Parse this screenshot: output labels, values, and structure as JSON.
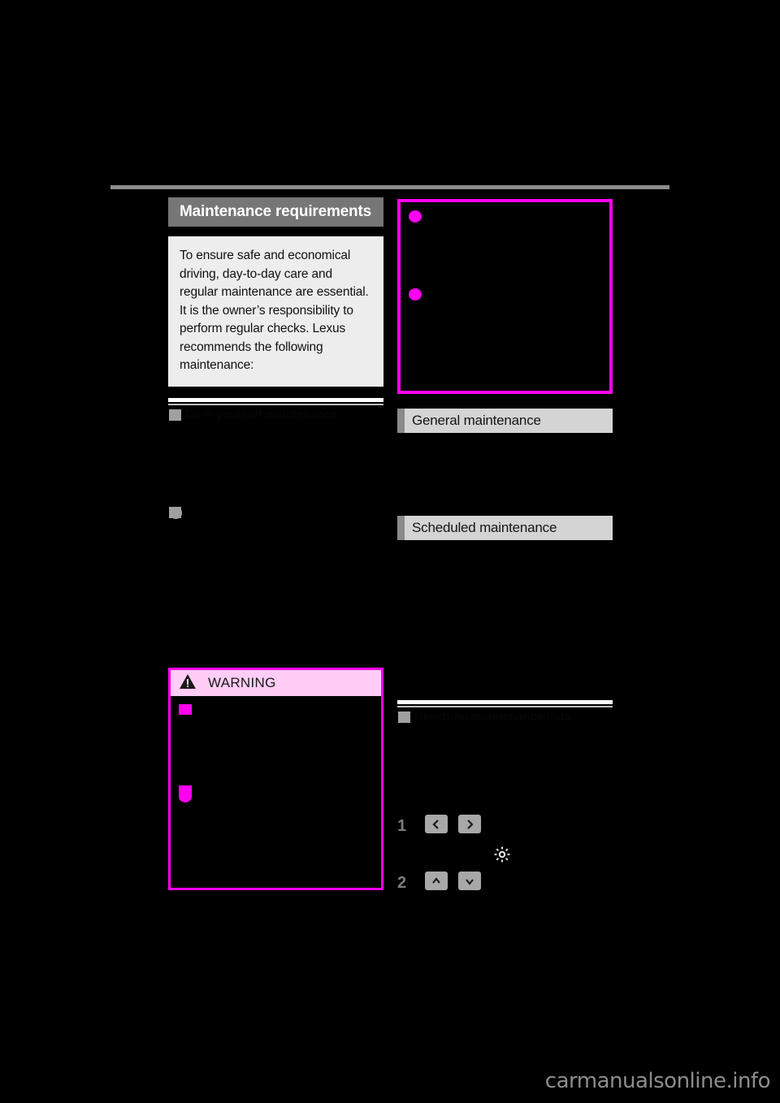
{
  "page": {
    "background_color": "#000000",
    "accent_magenta": "#ff00f0",
    "accent_pink_header": "#ffcdf6",
    "gray_title_bar": "#767676",
    "gray_subhead": "#d4d4d4",
    "watermark": "carmanualsonline.info"
  },
  "left_column": {
    "section_title": "Maintenance requirements",
    "intro_text": "To ensure safe and economical driving, day-to-day care and regular maintenance are essential. It is the owner’s responsibility to perform regular checks. Lexus recommends the following maintenance:",
    "subheads": [
      {
        "label": "Do-it-yourself maintenance"
      },
      {
        "label": ""
      }
    ],
    "bullets": [
      {
        "marker": "circle",
        "text": ""
      },
      {
        "marker": "circle",
        "text": ""
      }
    ],
    "warning": {
      "header_label": "WARNING",
      "icon": "warning-triangle-icon",
      "items": [
        {
          "marker": "square",
          "text": ""
        },
        {
          "marker": "square",
          "text": ""
        },
        {
          "marker": "circle",
          "text": ""
        }
      ]
    }
  },
  "right_column": {
    "note_box": {
      "items": [
        {
          "marker": "circle",
          "text": ""
        },
        {
          "marker": "circle",
          "text": ""
        }
      ]
    },
    "subheads": [
      {
        "label": "General maintenance"
      },
      {
        "label": "Scheduled maintenance"
      }
    ],
    "divider_head": {
      "label": "Resetting maintenance data"
    },
    "steps": [
      {
        "number": "1",
        "text_before": "",
        "keys": [
          "chevron-left",
          "chevron-right"
        ],
        "text_after": "",
        "gear_icon": "gear-icon"
      },
      {
        "number": "2",
        "text_before": "",
        "keys": [
          "chevron-up",
          "chevron-down"
        ],
        "text_after": ""
      }
    ]
  }
}
